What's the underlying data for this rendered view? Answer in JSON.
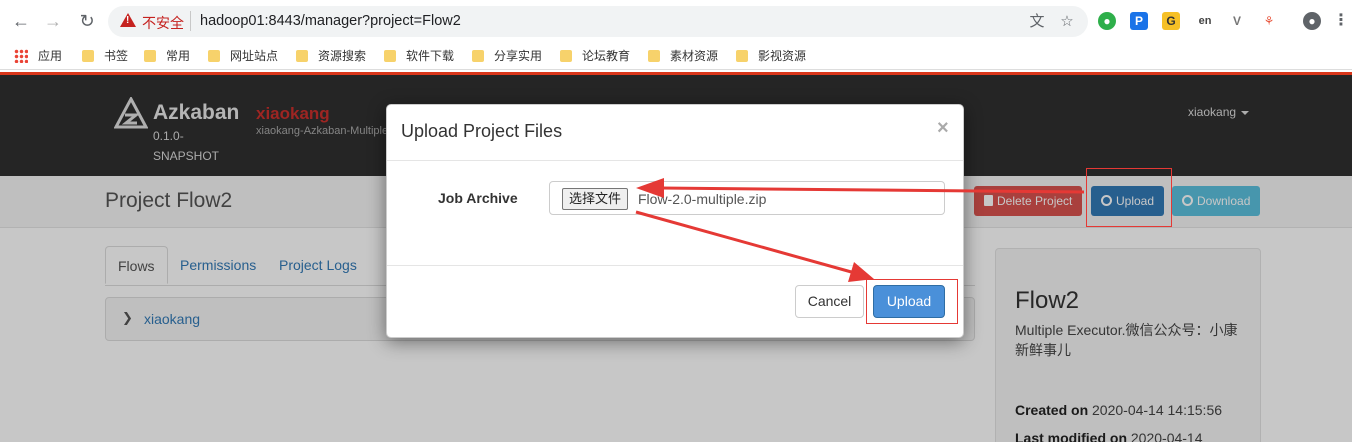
{
  "browser": {
    "unsafe_label": "不安全",
    "url": "hadoop01:8443/manager?project=Flow2"
  },
  "bookmarks": [
    {
      "label": "应用",
      "icon": "apps-grid-icon"
    },
    {
      "label": "书签",
      "icon": "folder-icon"
    },
    {
      "label": "常用",
      "icon": "folder-icon"
    },
    {
      "label": "网址站点",
      "icon": "folder-icon"
    },
    {
      "label": "资源搜索",
      "icon": "folder-icon"
    },
    {
      "label": "软件下载",
      "icon": "folder-icon"
    },
    {
      "label": "分享实用",
      "icon": "folder-icon"
    },
    {
      "label": "论坛教育",
      "icon": "folder-icon"
    },
    {
      "label": "素材资源",
      "icon": "folder-icon"
    },
    {
      "label": "影视资源",
      "icon": "folder-icon"
    }
  ],
  "header": {
    "brand": "Azkaban",
    "version": "0.1.0-SNAPSHOT",
    "user_title": "xiaokang",
    "user_subtitle": "xiaokang-Azkaban-Multiple",
    "user_menu": "xiaokang"
  },
  "project": {
    "title": "Project Flow2",
    "delete_label": "Delete Project",
    "upload_label": "Upload",
    "download_label": "Download"
  },
  "tabs": [
    "Flows",
    "Permissions",
    "Project Logs"
  ],
  "flows": [
    {
      "name": "xiaokang"
    }
  ],
  "side": {
    "name": "Flow2",
    "description": "Multiple Executor.微信公众号：小康新鲜事儿",
    "created_label": "Created on",
    "created_value": "2020-04-14 14:15:56",
    "modified_label": "Last modified on",
    "modified_value": "2020-04-14"
  },
  "modal": {
    "title": "Upload Project Files",
    "close": "×",
    "field_label": "Job Archive",
    "choose_file": "选择文件",
    "file_name": "Flow-2.0-multiple.zip",
    "cancel": "Cancel",
    "upload": "Upload"
  },
  "colors": {
    "annotation": "#e53935",
    "primary": "#337ab7",
    "danger": "#d9534f",
    "info": "#5bc0de"
  }
}
